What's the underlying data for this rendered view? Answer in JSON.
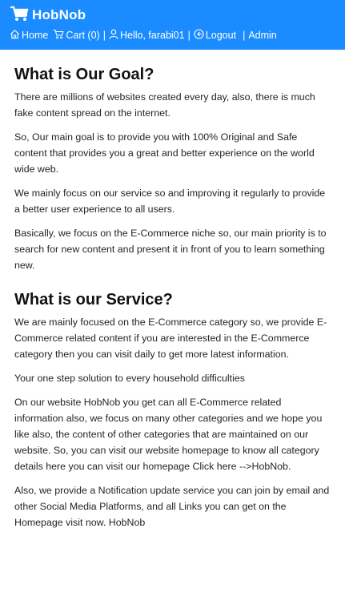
{
  "navbar": {
    "brand": "HobNob",
    "links": {
      "home": "Home",
      "cart": "Cart (0)",
      "user": "Hello, farabi01",
      "logout": "Logout",
      "admin": "Admin"
    },
    "separator": "|",
    "background_color": "#1a8cff"
  },
  "sections": [
    {
      "heading": "What is Our Goal?",
      "paragraphs": [
        "There are millions of websites created every day, also, there is much fake content spread on the internet.",
        "So, Our main goal is to provide you with 100% Original and Safe content that provides you a great and better experience on the world wide web.",
        "We mainly focus on our service so and improving it regularly to provide a better user experience to all users.",
        "Basically, we focus on the E-Commerce niche so, our main priority is to search for new content and present it in front of you to learn something new."
      ]
    },
    {
      "heading": "What is our Service?",
      "paragraphs": [
        "We are mainly focused on the E-Commerce category so, we provide E-Commerce related content if you are interested in the E-Commerce category then you can visit daily to get more latest information.",
        "Your one step solution to every household difficulties",
        "On our website HobNob you get can all E-Commerce related information also, we focus on many other categories and we hope you like also, the content of other categories that are maintained on our website. So, you can visit our website homepage to know all category details here you can visit our homepage Click here -->HobNob.",
        "Also, we provide a Notification update service you can join by email and other Social Media Platforms, and all Links you can get on the Homepage visit now. HobNob"
      ]
    }
  ]
}
